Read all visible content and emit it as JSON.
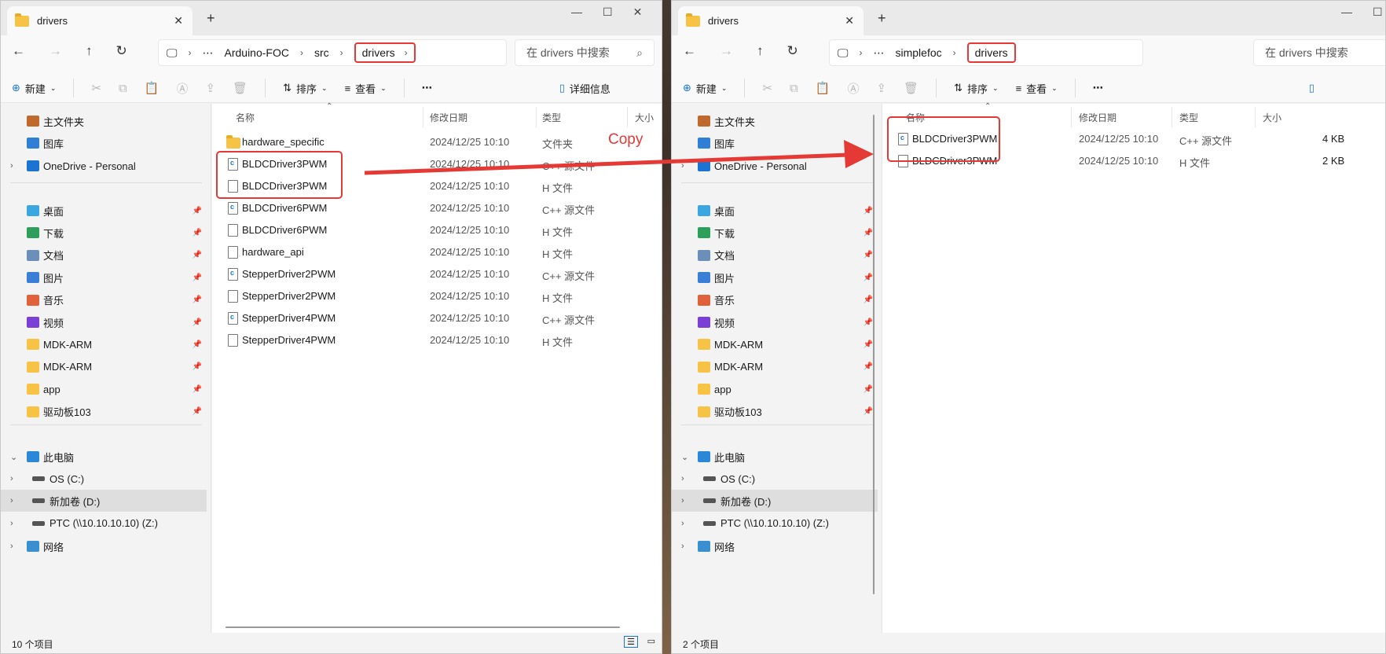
{
  "left": {
    "tab_title": "drivers",
    "breadcrumb": [
      "Arduino-FOC",
      "src",
      "drivers"
    ],
    "search_placeholder": "在 drivers 中搜索",
    "toolbar": {
      "new": "新建",
      "sort": "排序",
      "view": "查看",
      "details": "详细信息"
    },
    "columns": {
      "name": "名称",
      "date": "修改日期",
      "type": "类型",
      "size": "大小"
    },
    "files": [
      {
        "name": "hardware_specific",
        "date": "2024/12/25 10:10",
        "type": "文件夹",
        "icon": "folder-icon"
      },
      {
        "name": "BLDCDriver3PWM",
        "date": "2024/12/25 10:10",
        "type": "C++ 源文件",
        "icon": "cpp-file-icon"
      },
      {
        "name": "BLDCDriver3PWM",
        "date": "2024/12/25 10:10",
        "type": "H 文件",
        "icon": "h-file-icon"
      },
      {
        "name": "BLDCDriver6PWM",
        "date": "2024/12/25 10:10",
        "type": "C++ 源文件",
        "icon": "cpp-file-icon"
      },
      {
        "name": "BLDCDriver6PWM",
        "date": "2024/12/25 10:10",
        "type": "H 文件",
        "icon": "h-file-icon"
      },
      {
        "name": "hardware_api",
        "date": "2024/12/25 10:10",
        "type": "H 文件",
        "icon": "h-file-icon"
      },
      {
        "name": "StepperDriver2PWM",
        "date": "2024/12/25 10:10",
        "type": "C++ 源文件",
        "icon": "cpp-file-icon"
      },
      {
        "name": "StepperDriver2PWM",
        "date": "2024/12/25 10:10",
        "type": "H 文件",
        "icon": "h-file-icon"
      },
      {
        "name": "StepperDriver4PWM",
        "date": "2024/12/25 10:10",
        "type": "C++ 源文件",
        "icon": "cpp-file-icon"
      },
      {
        "name": "StepperDriver4PWM",
        "date": "2024/12/25 10:10",
        "type": "H 文件",
        "icon": "h-file-icon"
      }
    ],
    "status": "10 个项目"
  },
  "right": {
    "tab_title": "drivers",
    "breadcrumb": [
      "simplefoc",
      "drivers"
    ],
    "search_placeholder": "在 drivers 中搜索",
    "toolbar": {
      "new": "新建",
      "sort": "排序",
      "view": "查看"
    },
    "columns": {
      "name": "名称",
      "date": "修改日期",
      "type": "类型",
      "size": "大小"
    },
    "files": [
      {
        "name": "BLDCDriver3PWM",
        "date": "2024/12/25 10:10",
        "type": "C++ 源文件",
        "size": "4 KB",
        "icon": "cpp-file-icon"
      },
      {
        "name": "BLDCDriver3PWM",
        "date": "2024/12/25 10:10",
        "type": "H 文件",
        "size": "2 KB",
        "icon": "h-file-icon"
      }
    ],
    "status": "2 个项目"
  },
  "sidebar": {
    "home": "主文件夹",
    "gallery": "图库",
    "onedrive": "OneDrive - Personal",
    "quick": [
      "桌面",
      "下载",
      "文档",
      "图片",
      "音乐",
      "视频",
      "MDK-ARM",
      "MDK-ARM",
      "app",
      "驱动板103"
    ],
    "this_pc": "此电脑",
    "drives": [
      "OS (C:)",
      "新加卷 (D:)",
      "PTC (\\\\10.10.10.10) (Z:)"
    ],
    "network": "网络"
  },
  "annotation": {
    "copy_label": "Copy",
    "color": "#e53935"
  }
}
